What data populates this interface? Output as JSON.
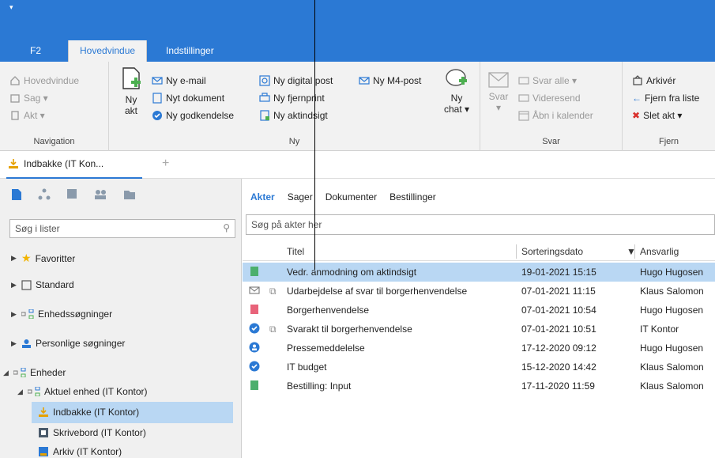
{
  "quick_access": "▾",
  "tabs": [
    {
      "label": "F2"
    },
    {
      "label": "Hovedvindue"
    },
    {
      "label": "Indstillinger"
    }
  ],
  "ribbon": {
    "navigation": {
      "title": "Navigation",
      "items": [
        "Hovedvindue",
        "Sag ▾",
        "Akt ▾"
      ]
    },
    "ny": {
      "title": "Ny",
      "ny_akt": "Ny\nakt",
      "items": [
        "Ny e-mail",
        "Nyt dokument",
        "Ny godkendelse",
        "Ny digital post",
        "Ny fjernprint",
        "Ny aktindsigt",
        "Ny M4-post"
      ],
      "ny_chat": "Ny\nchat ▾"
    },
    "svar": {
      "title": "Svar",
      "svar": "Svar\n▾",
      "items": [
        "Svar alle ▾",
        "Videresend",
        "Åbn i kalender"
      ]
    },
    "fjern": {
      "title": "Fjern",
      "items": [
        "Arkivér",
        "Fjern fra liste",
        "Slet akt ▾"
      ]
    }
  },
  "doc_tab": {
    "label": "Indbakke (IT Kon...",
    "plus": "+"
  },
  "left": {
    "search_placeholder": "Søg i lister",
    "tree": [
      {
        "label": "Favoritter"
      },
      {
        "label": "Standard"
      },
      {
        "label": "Enhedssøgninger"
      },
      {
        "label": "Personlige søgninger"
      },
      {
        "label": "Enheder"
      },
      {
        "label": "Aktuel enhed (IT Kontor)"
      },
      {
        "label": "Indbakke (IT Kontor)"
      },
      {
        "label": "Skrivebord (IT Kontor)"
      },
      {
        "label": "Arkiv (IT Kontor)"
      }
    ]
  },
  "right": {
    "tabs": [
      "Akter",
      "Sager",
      "Dokumenter",
      "Bestillinger"
    ],
    "search_placeholder": "Søg på akter her",
    "columns": [
      "Titel",
      "Sorteringsdato",
      "Ansvarlig"
    ],
    "rows": [
      {
        "icon": "green-doc-icon",
        "attach": false,
        "title": "Vedr. anmodning om aktindsigt",
        "date": "19-01-2021 15:15",
        "owner": "Hugo Hugosen"
      },
      {
        "icon": "envelope-icon",
        "attach": true,
        "title": "Udarbejdelse af svar til borgerhenvendelse",
        "date": "07-01-2021 11:15",
        "owner": "Klaus Salomon"
      },
      {
        "icon": "red-doc-icon",
        "attach": false,
        "title": "Borgerhenvendelse",
        "date": "07-01-2021 10:54",
        "owner": "Hugo Hugosen"
      },
      {
        "icon": "check-circle-icon",
        "attach": true,
        "title": "Svarakt til borgerhenvendelse",
        "date": "07-01-2021 10:51",
        "owner": "IT Kontor"
      },
      {
        "icon": "person-circle-icon",
        "attach": false,
        "title": "Pressemeddelelse",
        "date": "17-12-2020 09:12",
        "owner": "Hugo Hugosen"
      },
      {
        "icon": "check-circle-icon",
        "attach": false,
        "title": "IT budget",
        "date": "15-12-2020 14:42",
        "owner": "Klaus Salomon"
      },
      {
        "icon": "green-doc-icon",
        "attach": false,
        "title": "Bestilling: Input",
        "date": "17-11-2020 11:59",
        "owner": "Klaus Salomon"
      }
    ]
  },
  "colors": {
    "accent": "#2b79d4",
    "selection": "#b9d7f3"
  }
}
